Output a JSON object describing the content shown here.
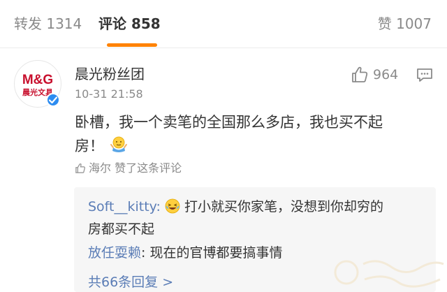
{
  "tabs": {
    "repost": "转发 1314",
    "comments": "评论 858",
    "likes": "赞 1007"
  },
  "colors": {
    "accent": "#ff8200",
    "link": "#5b7db6",
    "muted": "#8a8a8a",
    "verified": "#2d8cf0"
  },
  "comment": {
    "avatar": {
      "logo_text": "M&G",
      "sub_text": "晨光文具"
    },
    "username": "晨光粉丝团",
    "timestamp": "10-31 21:58",
    "like_count": "964",
    "text_line1": "卧槽，我一个卖笔的全国那么多店，我也买不起",
    "text_line2": "房！",
    "emoji": "shrug-emoji",
    "liked_by": "海尔 赞了这条评论"
  },
  "replies": {
    "items": [
      {
        "name": "Soft__kitty",
        "separator": ":",
        "emoji": "laughing-emoji",
        "text": "打小就买你家笔，没想到你却穷的",
        "text_cont": "房都买不起"
      },
      {
        "name": "放任耍赖",
        "separator": ":",
        "text": " 现在的官博都要搞事情"
      }
    ],
    "more_label": "共66条回复 >"
  },
  "icons": [
    "thumbs-up-icon",
    "reply-icon",
    "verified-icon",
    "shrug-emoji",
    "laughing-emoji"
  ]
}
